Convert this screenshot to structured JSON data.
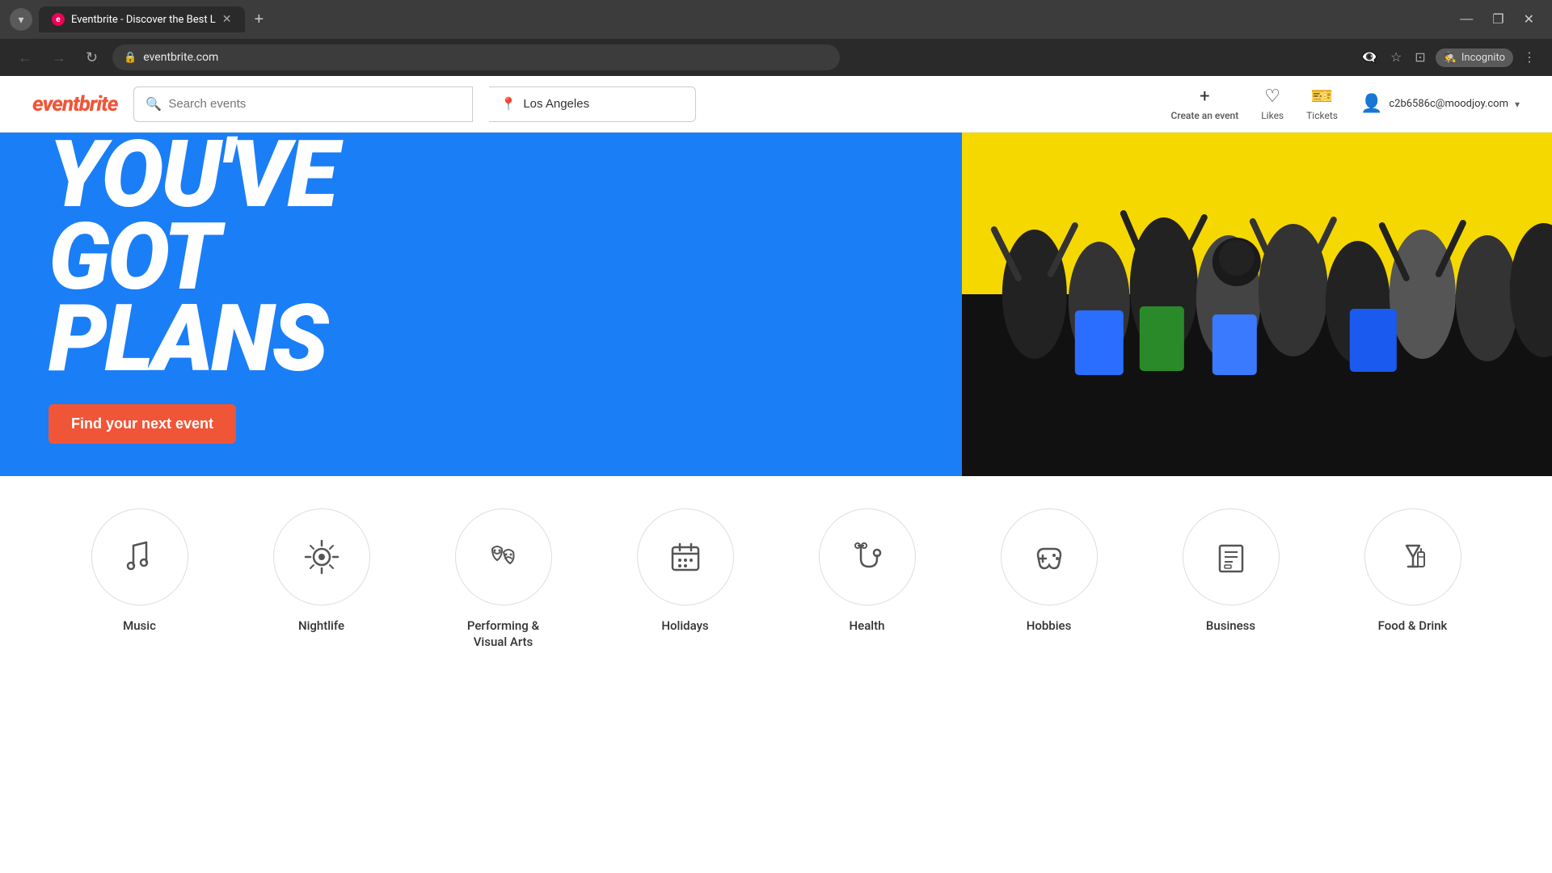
{
  "browser": {
    "tab_title": "Eventbrite - Discover the Best L",
    "tab_favicon": "e",
    "address": "eventbrite.com",
    "new_tab_label": "+",
    "controls": {
      "minimize": "—",
      "maximize": "❐",
      "close": "✕"
    },
    "nav": {
      "back": "←",
      "forward": "→",
      "reload": "↻"
    },
    "toolbar": {
      "eye_off": "👁",
      "star": "☆",
      "extensions": "⊞",
      "incognito": "Incognito",
      "menu": "⋮"
    }
  },
  "header": {
    "logo": "eventbrite",
    "search_placeholder": "Search events",
    "location_value": "Los Angeles",
    "create_label": "Create an event",
    "likes_label": "Likes",
    "tickets_label": "Tickets",
    "user_email": "c2b6586c@moodjoy.com"
  },
  "hero": {
    "line1": "YOU'VE",
    "line2": "GOT",
    "line3": "PLANS",
    "cta_label": "Find your next event"
  },
  "categories": [
    {
      "id": "music",
      "label": "Music",
      "icon": "🎤"
    },
    {
      "id": "nightlife",
      "label": "Nightlife",
      "icon": "🪩"
    },
    {
      "id": "performing-visual-arts",
      "label": "Performing & Visual Arts",
      "icon": "🎭"
    },
    {
      "id": "holidays",
      "label": "Holidays",
      "icon": "🗓"
    },
    {
      "id": "health",
      "label": "Health",
      "icon": "🩺"
    },
    {
      "id": "hobbies",
      "label": "Hobbies",
      "icon": "🎮"
    },
    {
      "id": "business",
      "label": "Business",
      "icon": "📋"
    },
    {
      "id": "food-drink",
      "label": "Food & Drink",
      "icon": "🍹"
    }
  ]
}
